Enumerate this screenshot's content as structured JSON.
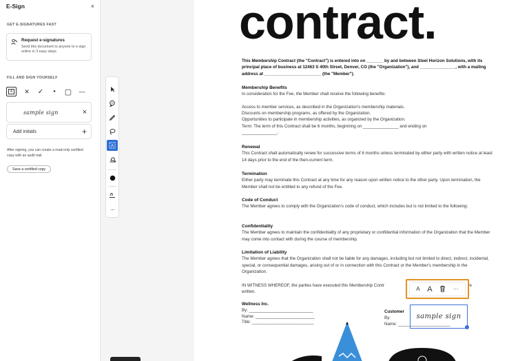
{
  "panel": {
    "title": "E-Sign",
    "close_glyph": "×",
    "section1": "GET E-SIGNATURES FAST",
    "request": {
      "title": "Request e-signatures",
      "desc": "Send this document to anyone to e-sign online in 3 easy steps"
    },
    "section2": "FILL AND SIGN YOURSELF",
    "tools": [
      {
        "name": "text-tool",
        "glyph": "A"
      },
      {
        "name": "cross-tool",
        "glyph": "✕"
      },
      {
        "name": "check-tool",
        "glyph": "✓"
      },
      {
        "name": "dot-tool",
        "glyph": "●"
      },
      {
        "name": "rectangle-tool",
        "glyph": "▢"
      },
      {
        "name": "line-tool",
        "glyph": "—"
      }
    ],
    "signature_sample": "sample sign",
    "delete_glyph": "×",
    "add_initials": "Add initials",
    "plus_glyph": "+",
    "after_text": "After signing, you can create a read-only certified copy with an audit trail.",
    "cert_button": "Save a certified copy"
  },
  "toolbar": {
    "icons": [
      "select-arrow-icon",
      "comment-icon",
      "pen-icon",
      "lasso-icon",
      "text-field-icon",
      "stamp-icon",
      "circle-icon",
      "sign-icon",
      "more-icon"
    ],
    "more_glyph": "···"
  },
  "doc": {
    "title": "contract.",
    "intro": "This Membership Contract (the \"Contract\") is entered into on _______ by and between Steel Horizon Solutions, with its principal place of business at 12463 S 40th Street, Denver, CO (the \"Organization\"), and _______________, with a mailing address at ________________________ (the \"Member\").",
    "sections": [
      {
        "heading": "Membership Benefits",
        "lines": [
          "In consideration for the Fee, the Member shall receive the following benefits:",
          "",
          "Access to member services, as described in the Organization's membership materials.",
          "Discounts on membership programs, as offered by the Organization.",
          "Opportunities to participate in membership activities, as organized by the Organization.",
          "Term: The term of this Contract shall be 6 months, beginning on _______________ and ending on",
          "_______________."
        ]
      },
      {
        "heading": "Renewal",
        "lines": [
          "This Contract shall automatically renew for successive terms of 6 months unless terminated by either party with written notice at least 14 days prior to the end of the then-current term."
        ]
      },
      {
        "heading": "Termination",
        "lines": [
          "Either party may terminate this Contract at any time for any reason upon written notice to the other party. Upon termination, the Member shall not be entitled to any refund of the Fee."
        ]
      },
      {
        "heading": "Code of Conduct",
        "lines": [
          "The Member agrees to comply with the Organization's code of conduct, which includes but is not limited to the following:"
        ]
      },
      {
        "heading": "Confidentiality",
        "lines": [
          "The Member agrees to maintain the confidentiality of any proprietary or confidential information of the Organization that the Member may come into contact with during the course of membership."
        ]
      },
      {
        "heading": "Limitation of Liability",
        "lines": [
          "The Member agrees that the Organization shall not be liable for any damages, including but not limited to direct, indirect, incidental, special, or consequential damages, arising out of or in connection with this Contract or the Member's membership in the Organization."
        ]
      }
    ],
    "witness": "IN WITNESS WHEREOF, the parties have executed this Membership Contr",
    "witness_tail": "ave",
    "witness2": "written.",
    "org": {
      "name": "Wellness Inc.",
      "by": "By: ___________________________",
      "name_line": "Name: _________________________",
      "title_line": "Title: __________________________"
    },
    "customer": {
      "name": "Customer",
      "by": "By:",
      "name_line": "Name: ______________________"
    }
  },
  "float_toolbar": {
    "small_a": "A",
    "large_a": "A",
    "more": "···"
  },
  "placed_signature": "sample sign",
  "colors": {
    "accent_orange": "#e3921f",
    "selection_blue": "#3a72d6",
    "active_tool_blue": "#2e6fd6"
  }
}
